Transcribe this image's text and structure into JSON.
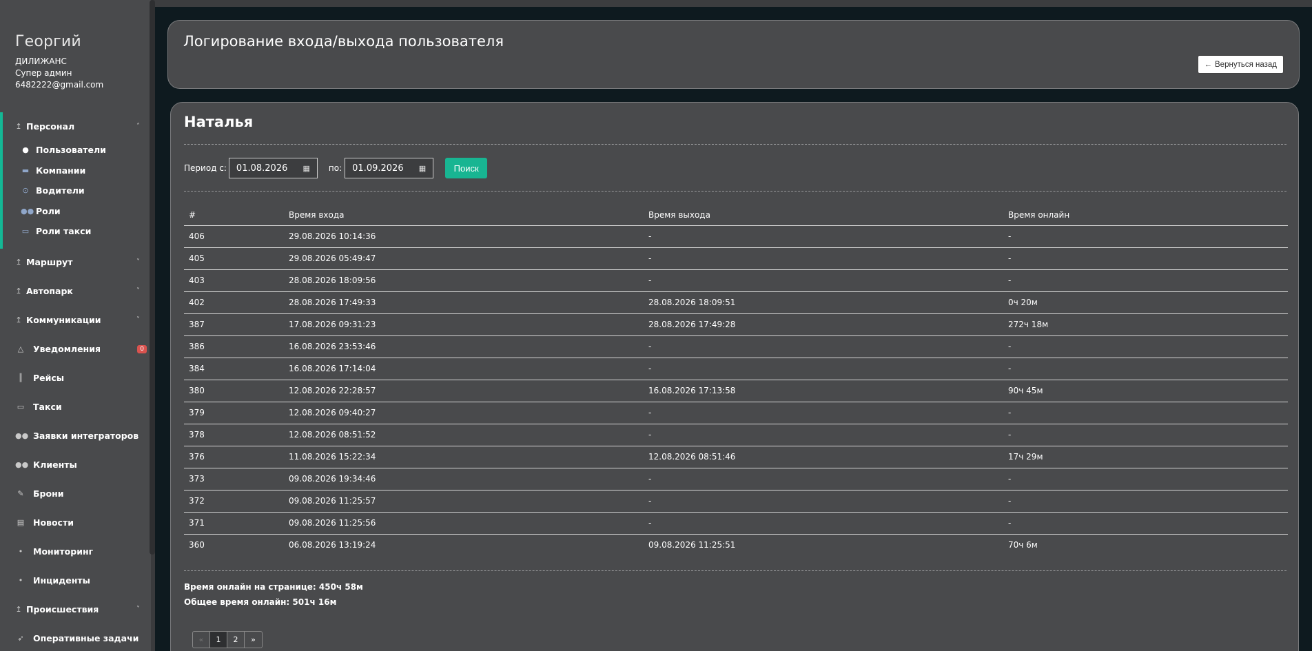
{
  "profile": {
    "name": "Георгий",
    "company": "ДИЛИЖАНС",
    "role": "Супер админ",
    "email": "6482222@gmail.com"
  },
  "sidebar": {
    "personnel": {
      "label": "Персонал",
      "items": [
        {
          "label": "Пользователи",
          "icon": "user-icon"
        },
        {
          "label": "Компании",
          "icon": "briefcase-icon"
        },
        {
          "label": "Водители",
          "icon": "steering-wheel-icon"
        },
        {
          "label": "Роли",
          "icon": "users-icon"
        },
        {
          "label": "Роли такси",
          "icon": "car-icon"
        }
      ]
    },
    "items": [
      {
        "label": "Маршрут",
        "icon": "arrow-up-icon",
        "expandable": true
      },
      {
        "label": "Автопарк",
        "icon": "arrow-up-icon",
        "expandable": true
      },
      {
        "label": "Коммуникации",
        "icon": "arrow-up-icon",
        "expandable": true
      },
      {
        "label": "Уведомления",
        "icon": "bell-icon",
        "badge": "0"
      },
      {
        "label": "Рейсы",
        "icon": "road-icon"
      },
      {
        "label": "Такси",
        "icon": "car-icon"
      },
      {
        "label": "Заявки интеграторов",
        "icon": "users-icon"
      },
      {
        "label": "Клиенты",
        "icon": "users-icon"
      },
      {
        "label": "Брони",
        "icon": "edit-icon"
      },
      {
        "label": "Новости",
        "icon": "newspaper-icon"
      },
      {
        "label": "Мониторинг",
        "icon": "map-marker-icon"
      },
      {
        "label": "Инциденты",
        "icon": "map-marker-icon"
      },
      {
        "label": "Происшествия",
        "icon": "arrow-up-icon",
        "expandable": true
      },
      {
        "label": "Оперативные задачи",
        "icon": "rocket-icon"
      }
    ]
  },
  "header": {
    "title": "Логирование входа/выхода пользователя",
    "back_label": "Вернуться назад"
  },
  "main": {
    "user_name": "Наталья",
    "filter": {
      "from_label": "Период с:",
      "from_value": "01.08.2026",
      "to_label": "по:",
      "to_value": "01.09.2026",
      "search_label": "Поиск"
    },
    "table": {
      "headers": [
        "#",
        "Время входа",
        "Время выхода",
        "Время онлайн"
      ],
      "rows": [
        [
          "406",
          "29.08.2026 10:14:36",
          "-",
          "-"
        ],
        [
          "405",
          "29.08.2026 05:49:47",
          "-",
          "-"
        ],
        [
          "403",
          "28.08.2026 18:09:56",
          "-",
          "-"
        ],
        [
          "402",
          "28.08.2026 17:49:33",
          "28.08.2026 18:09:51",
          "0ч 20м"
        ],
        [
          "387",
          "17.08.2026 09:31:23",
          "28.08.2026 17:49:28",
          "272ч 18м"
        ],
        [
          "386",
          "16.08.2026 23:53:46",
          "-",
          "-"
        ],
        [
          "384",
          "16.08.2026 17:14:04",
          "-",
          "-"
        ],
        [
          "380",
          "12.08.2026 22:28:57",
          "16.08.2026 17:13:58",
          "90ч 45м"
        ],
        [
          "379",
          "12.08.2026 09:40:27",
          "-",
          "-"
        ],
        [
          "378",
          "12.08.2026 08:51:52",
          "-",
          "-"
        ],
        [
          "376",
          "11.08.2026 15:22:34",
          "12.08.2026 08:51:46",
          "17ч 29м"
        ],
        [
          "373",
          "09.08.2026 19:34:46",
          "-",
          "-"
        ],
        [
          "372",
          "09.08.2026 11:25:57",
          "-",
          "-"
        ],
        [
          "371",
          "09.08.2026 11:25:56",
          "-",
          "-"
        ],
        [
          "360",
          "06.08.2026 13:19:24",
          "09.08.2026 11:25:51",
          "70ч 6м"
        ]
      ]
    },
    "totals": {
      "page_online": "Время онлайн на странице: 450ч 58м",
      "total_online": "Общее время онлайн: 501ч 16м"
    },
    "pagination": {
      "prev": "«",
      "pages": [
        "1",
        "2"
      ],
      "current": "1",
      "next": "»"
    }
  },
  "colors": {
    "accent": "#18b592",
    "panel": "#494a4c",
    "background": "#0e1a1f",
    "badge": "#d9534f"
  }
}
